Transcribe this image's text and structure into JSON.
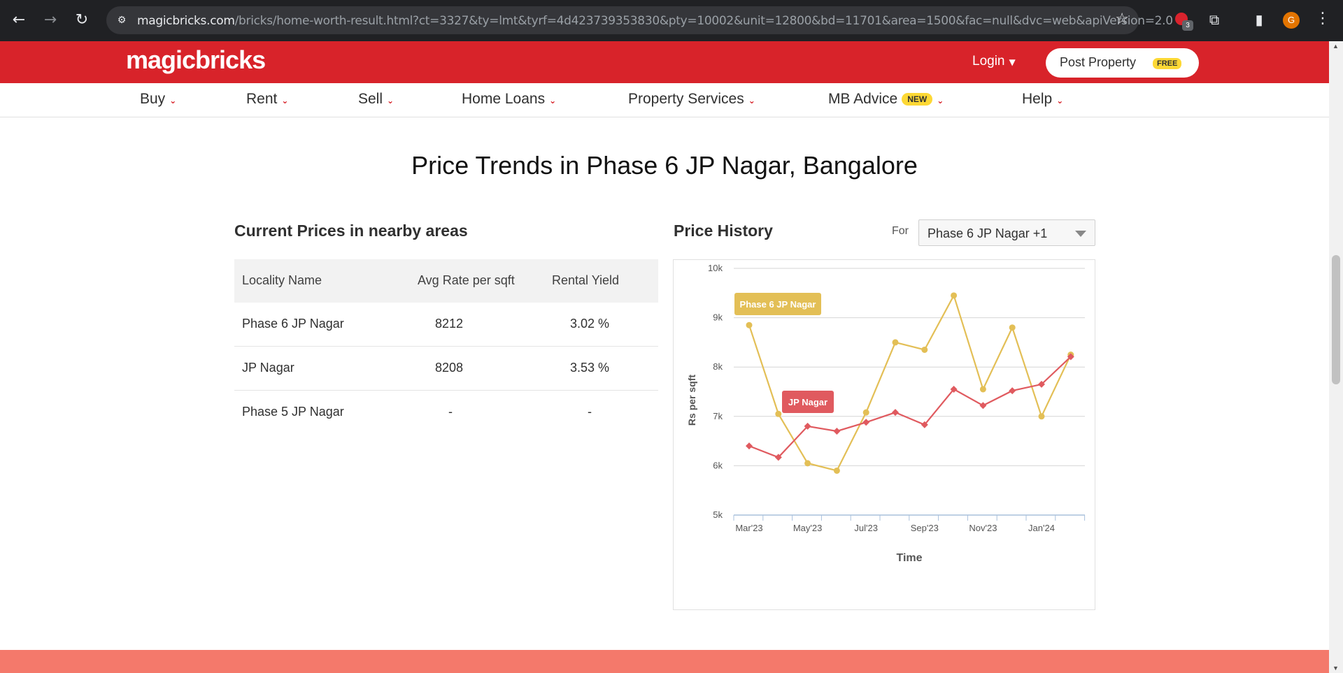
{
  "browser": {
    "url_host": "magicbricks.com",
    "url_path": "/bricks/home-worth-result.html?ct=3327&ty=lmt&tyrf=4d423739353830&pty=10002&unit=12800&bd=11701&area=1500&fac=null&dvc=web&apiVersion=2.0",
    "ext_badge_count": "3",
    "profile_initial": "G",
    "icons": [
      "back-icon",
      "forward-icon",
      "reload-icon",
      "site-settings-icon",
      "bookmark-star-icon",
      "extensions-icon",
      "side-panel-icon",
      "menu-icon"
    ]
  },
  "header": {
    "logo": "magicbricks",
    "login_label": "Login",
    "post_property_label": "Post Property",
    "free_badge": "FREE",
    "brand_color": "#d8232a"
  },
  "menu": {
    "items": [
      {
        "label": "Buy"
      },
      {
        "label": "Rent"
      },
      {
        "label": "Sell"
      },
      {
        "label": "Home Loans"
      },
      {
        "label": "Property Services"
      },
      {
        "label": "MB Advice",
        "badge": "NEW"
      },
      {
        "label": "Help"
      }
    ]
  },
  "main": {
    "title": "Price Trends in Phase 6 JP Nagar, Bangalore",
    "nearby": {
      "heading": "Current Prices in nearby areas",
      "columns": [
        "Locality Name",
        "Avg Rate per sqft",
        "Rental Yield"
      ],
      "rows": [
        {
          "locality": "Phase 6 JP Nagar",
          "rate": "8212",
          "yield": "3.02 %"
        },
        {
          "locality": "JP Nagar",
          "rate": "8208",
          "yield": "3.53 %"
        },
        {
          "locality": "Phase 5 JP Nagar",
          "rate": "-",
          "yield": "-"
        }
      ]
    },
    "history": {
      "heading": "Price History",
      "for_label": "For",
      "selected": "Phase 6 JP Nagar +1"
    }
  },
  "chart_data": {
    "type": "line",
    "x": [
      "Mar'23",
      "Apr'23",
      "May'23",
      "Jun'23",
      "Jul'23",
      "Aug'23",
      "Sep'23",
      "Oct'23",
      "Nov'23",
      "Dec'23",
      "Jan'24",
      "Feb'24"
    ],
    "tick_labels": [
      "Mar'23",
      "May'23",
      "Jul'23",
      "Sep'23",
      "Nov'23",
      "Jan'24"
    ],
    "series": [
      {
        "name": "Phase 6 JP Nagar",
        "color": "#e3bf56",
        "values": [
          8850,
          7050,
          6050,
          5900,
          7080,
          8500,
          8350,
          9450,
          7550,
          8800,
          7000,
          8250
        ]
      },
      {
        "name": "JP Nagar",
        "color": "#e05a5f",
        "values": [
          6400,
          6170,
          6800,
          6700,
          6880,
          7080,
          6830,
          7550,
          7220,
          7520,
          7650,
          8210
        ]
      }
    ],
    "ylabel": "Rs per sqft",
    "xlabel": "Time",
    "ylim": [
      5000,
      10000
    ],
    "yticks": [
      "5k",
      "6k",
      "7k",
      "8k",
      "9k",
      "10k"
    ],
    "grid": true
  }
}
